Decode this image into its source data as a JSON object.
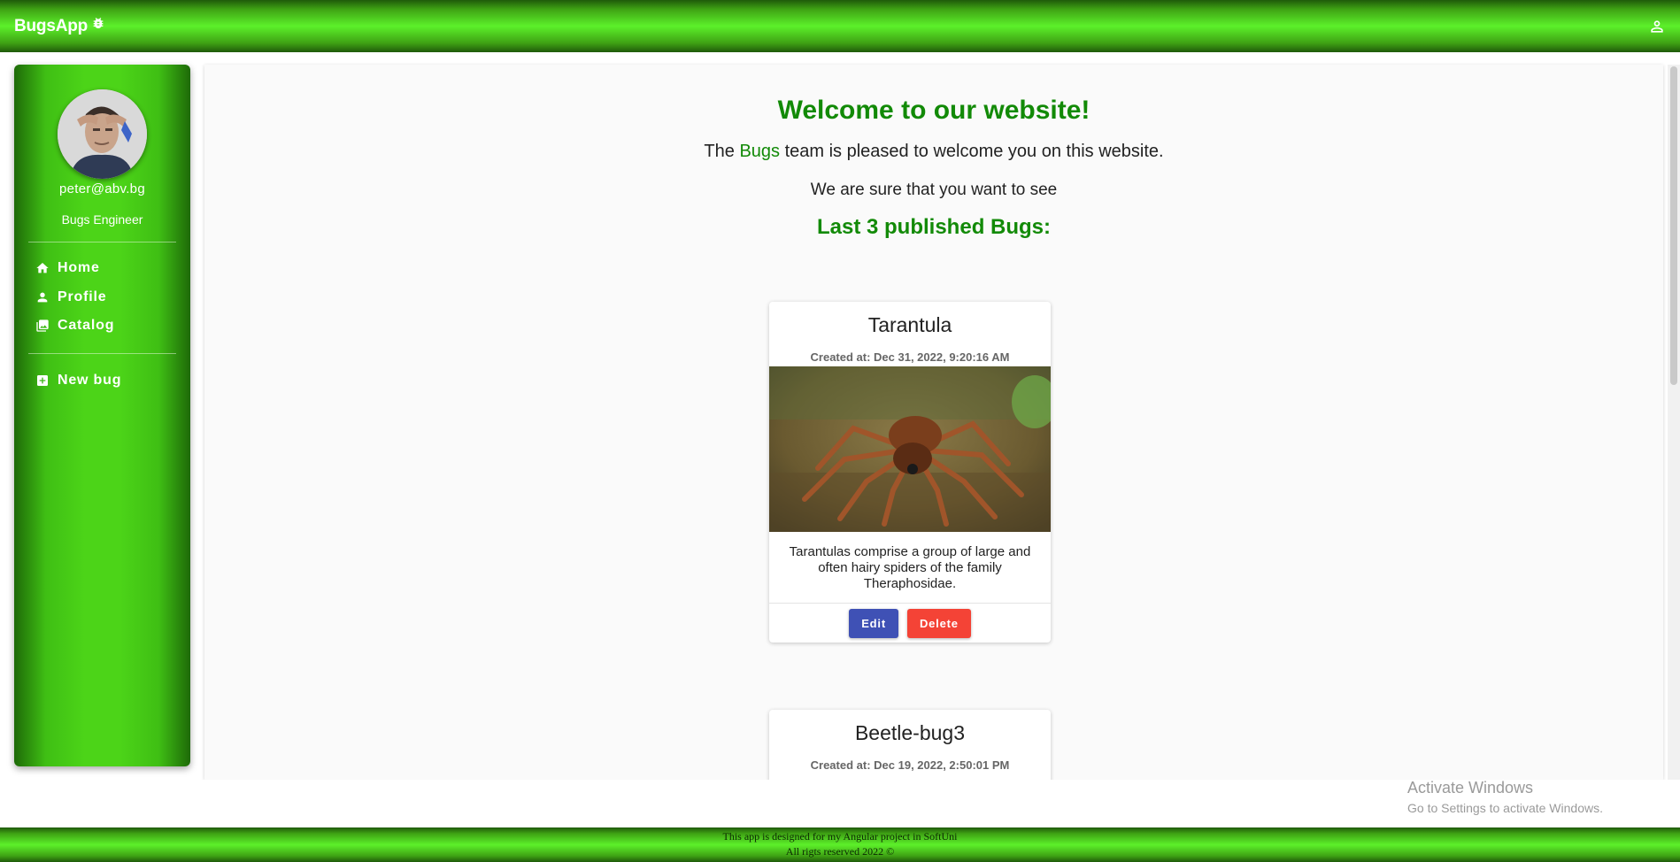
{
  "topbar": {
    "brand": "BugsApp",
    "brand_icon": "bug-icon",
    "user_icon": "account-icon"
  },
  "sidebar": {
    "avatar_alt": "user avatar",
    "email": "peter@abv.bg",
    "role": "Bugs Engineer",
    "nav": [
      {
        "label": "Home",
        "icon": "home-icon"
      },
      {
        "label": "Profile",
        "icon": "person-icon"
      },
      {
        "label": "Catalog",
        "icon": "photo-library-icon"
      }
    ],
    "new_bug": {
      "label": "New bug",
      "icon": "add-box-icon"
    }
  },
  "main": {
    "welcome": "Welcome to our website!",
    "intro_pre": "The ",
    "intro_highlight": "Bugs",
    "intro_post": " team is pleased to welcome you on this website.",
    "sure": "We are sure that you want to see",
    "last_heading": "Last 3 published Bugs:",
    "cards": [
      {
        "title": "Tarantula",
        "created": "Created at: Dec 31, 2022, 9:20:16 AM",
        "description": "Tarantulas comprise a group of large and often hairy spiders of the family Theraphosidae.",
        "edit_label": "Edit",
        "delete_label": "Delete"
      },
      {
        "title": "Beetle-bug3",
        "created": "Created at: Dec 19, 2022, 2:50:01 PM"
      }
    ]
  },
  "watermark": {
    "line1": "Activate Windows",
    "line2": "Go to Settings to activate Windows."
  },
  "footer": {
    "line1": "This app is designed for my Angular project in SoftUni",
    "line2": "All rigts reserved 2022 ©"
  },
  "colors": {
    "accent_green": "#128a07",
    "bar_green": "#5cf02a",
    "edit_blue": "#3f51b5",
    "delete_red": "#f44336"
  }
}
